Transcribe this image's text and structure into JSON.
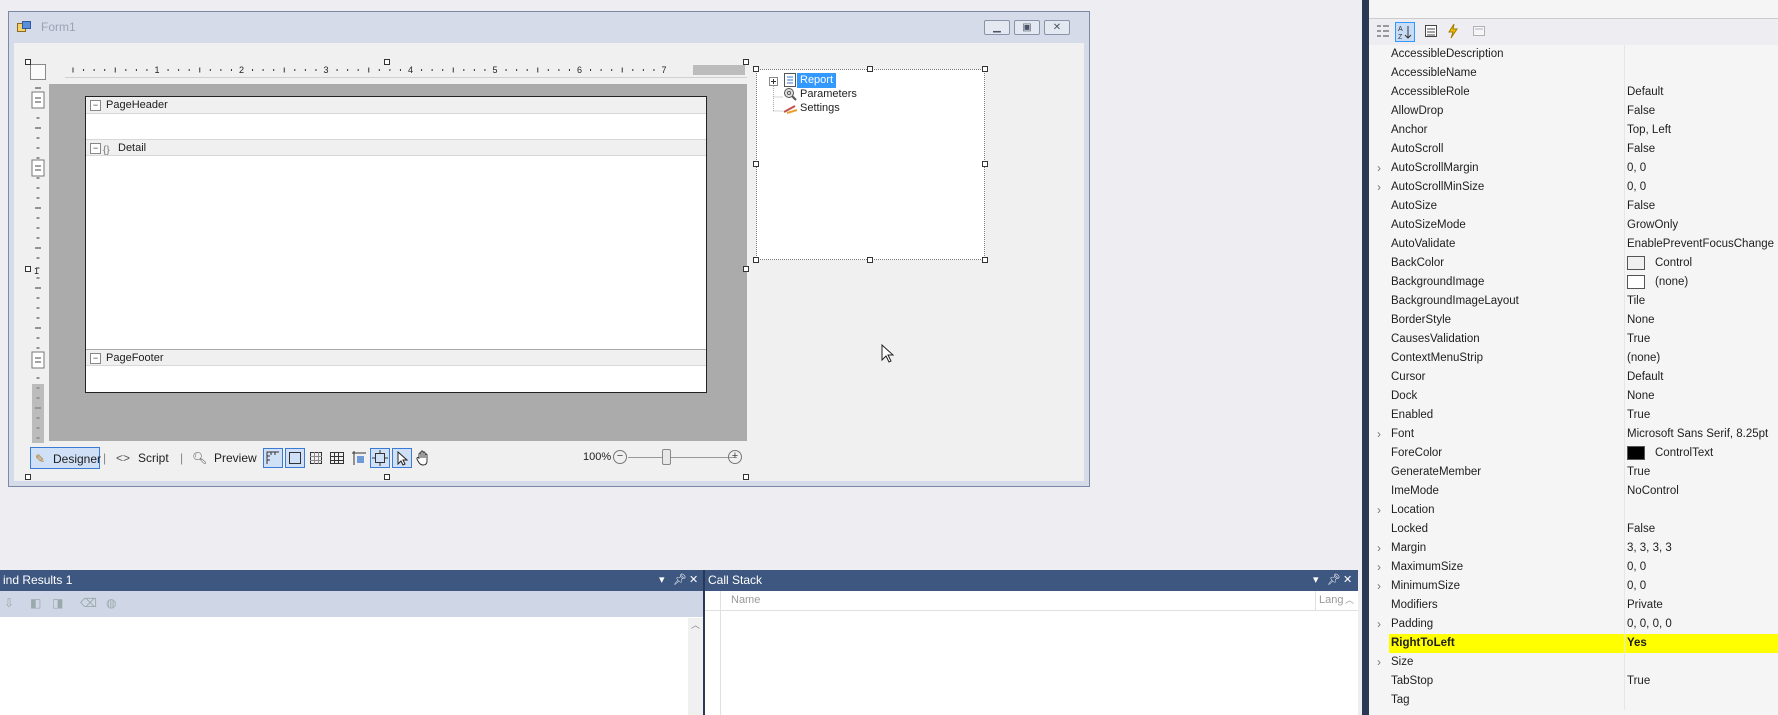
{
  "form": {
    "title": "Form1",
    "title_icon": "form-icon",
    "window_controls": [
      "minimize",
      "maximize",
      "close"
    ]
  },
  "designer": {
    "ruler_numbers": [
      "1",
      "2",
      "3",
      "4",
      "5",
      "6",
      "7"
    ],
    "vertical_ruler_number": "1",
    "bands": {
      "header": "PageHeader",
      "detail": "Detail",
      "footer": "PageFooter"
    },
    "toolbar": {
      "designer_label": "Designer",
      "script_label": "Script",
      "preview_label": "Preview",
      "zoom": "100%"
    }
  },
  "tree": {
    "items": [
      {
        "label": "Report",
        "icon": "report-icon",
        "selected": true
      },
      {
        "label": "Parameters",
        "icon": "parameters-icon",
        "selected": false
      },
      {
        "label": "Settings",
        "icon": "settings-icon",
        "selected": false
      }
    ]
  },
  "properties": {
    "rows": [
      {
        "name": "AccessibleDescription",
        "value": "",
        "expandable": false
      },
      {
        "name": "AccessibleName",
        "value": "",
        "expandable": false
      },
      {
        "name": "AccessibleRole",
        "value": "Default",
        "expandable": false
      },
      {
        "name": "AllowDrop",
        "value": "False",
        "expandable": false
      },
      {
        "name": "Anchor",
        "value": "Top, Left",
        "expandable": false
      },
      {
        "name": "AutoScroll",
        "value": "False",
        "expandable": false
      },
      {
        "name": "AutoScrollMargin",
        "value": "0, 0",
        "expandable": true
      },
      {
        "name": "AutoScrollMinSize",
        "value": "0, 0",
        "expandable": true
      },
      {
        "name": "AutoSize",
        "value": "False",
        "expandable": false
      },
      {
        "name": "AutoSizeMode",
        "value": "GrowOnly",
        "expandable": false
      },
      {
        "name": "AutoValidate",
        "value": "EnablePreventFocusChange",
        "expandable": false
      },
      {
        "name": "BackColor",
        "value": "Control",
        "expandable": false,
        "swatch": "#f0f0f0"
      },
      {
        "name": "BackgroundImage",
        "value": "(none)",
        "expandable": false,
        "swatch": "#ffffff"
      },
      {
        "name": "BackgroundImageLayout",
        "value": "Tile",
        "expandable": false
      },
      {
        "name": "BorderStyle",
        "value": "None",
        "expandable": false
      },
      {
        "name": "CausesValidation",
        "value": "True",
        "expandable": false
      },
      {
        "name": "ContextMenuStrip",
        "value": "(none)",
        "expandable": false
      },
      {
        "name": "Cursor",
        "value": "Default",
        "expandable": false
      },
      {
        "name": "Dock",
        "value": "None",
        "expandable": false
      },
      {
        "name": "Enabled",
        "value": "True",
        "expandable": false
      },
      {
        "name": "Font",
        "value": "Microsoft Sans Serif, 8.25pt",
        "expandable": true
      },
      {
        "name": "ForeColor",
        "value": "ControlText",
        "expandable": false,
        "swatch": "#000000"
      },
      {
        "name": "GenerateMember",
        "value": "True",
        "expandable": false
      },
      {
        "name": "ImeMode",
        "value": "NoControl",
        "expandable": false
      },
      {
        "name": "Location",
        "value": "",
        "expandable": true
      },
      {
        "name": "Locked",
        "value": "False",
        "expandable": false
      },
      {
        "name": "Margin",
        "value": "3, 3, 3, 3",
        "expandable": true
      },
      {
        "name": "MaximumSize",
        "value": "0, 0",
        "expandable": true
      },
      {
        "name": "MinimumSize",
        "value": "0, 0",
        "expandable": true
      },
      {
        "name": "Modifiers",
        "value": "Private",
        "expandable": false
      },
      {
        "name": "Padding",
        "value": "0, 0, 0, 0",
        "expandable": true
      },
      {
        "name": "RightToLeft",
        "value": "Yes",
        "expandable": false,
        "highlight": true
      },
      {
        "name": "Size",
        "value": "",
        "expandable": true
      },
      {
        "name": "TabStop",
        "value": "True",
        "expandable": false
      },
      {
        "name": "Tag",
        "value": "",
        "expandable": false
      }
    ]
  },
  "find_results": {
    "title": "ind Results 1"
  },
  "call_stack": {
    "title": "Call Stack",
    "columns": [
      "Name",
      "Lang"
    ]
  },
  "colors": {
    "highlight": "#ffff00",
    "tool_title": "#3e5780",
    "selection": "#3399ff"
  }
}
